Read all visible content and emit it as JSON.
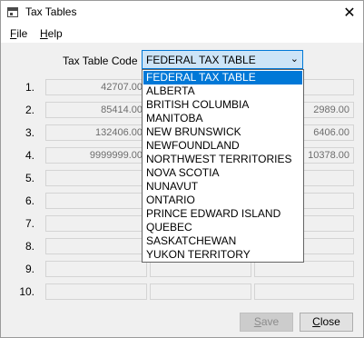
{
  "window": {
    "title": "Tax Tables",
    "close_glyph": "✕"
  },
  "menu": [
    {
      "accel": "F",
      "rest": "ile"
    },
    {
      "accel": "H",
      "rest": "elp"
    }
  ],
  "form": {
    "tax_table_code_label": "Tax Table Code",
    "selected_code": "FEDERAL TAX TABLE",
    "combo_arrow": "⌄"
  },
  "rows": [
    {
      "num": "1.",
      "c1": "42707.00",
      "c2": "",
      "c3": ""
    },
    {
      "num": "2.",
      "c1": "85414.00",
      "c2": "",
      "c3": "2989.00"
    },
    {
      "num": "3.",
      "c1": "132406.00",
      "c2": "",
      "c3": "6406.00"
    },
    {
      "num": "4.",
      "c1": "9999999.00",
      "c2": "",
      "c3": "10378.00"
    },
    {
      "num": "5.",
      "c1": "",
      "c2": "",
      "c3": ""
    },
    {
      "num": "6.",
      "c1": "",
      "c2": "",
      "c3": ""
    },
    {
      "num": "7.",
      "c1": "",
      "c2": "",
      "c3": ""
    },
    {
      "num": "8.",
      "c1": "",
      "c2": "",
      "c3": ""
    },
    {
      "num": "9.",
      "c1": "",
      "c2": "",
      "c3": ""
    },
    {
      "num": "10.",
      "c1": "",
      "c2": "",
      "c3": ""
    }
  ],
  "dropdown_options": [
    "FEDERAL TAX TABLE",
    "ALBERTA",
    "BRITISH COLUMBIA",
    "MANITOBA",
    "NEW BRUNSWICK",
    "NEWFOUNDLAND",
    "NORTHWEST TERRITORIES",
    "NOVA SCOTIA",
    "NUNAVUT",
    "ONTARIO",
    "PRINCE EDWARD ISLAND",
    "QUEBEC",
    "SASKATCHEWAN",
    "YUKON TERRITORY"
  ],
  "buttons": {
    "save": {
      "accel": "S",
      "rest": "ave"
    },
    "close": {
      "accel": "C",
      "rest": "lose"
    }
  },
  "colors": {
    "selection": "#0078d7",
    "combo_bg": "#cce4f7"
  }
}
